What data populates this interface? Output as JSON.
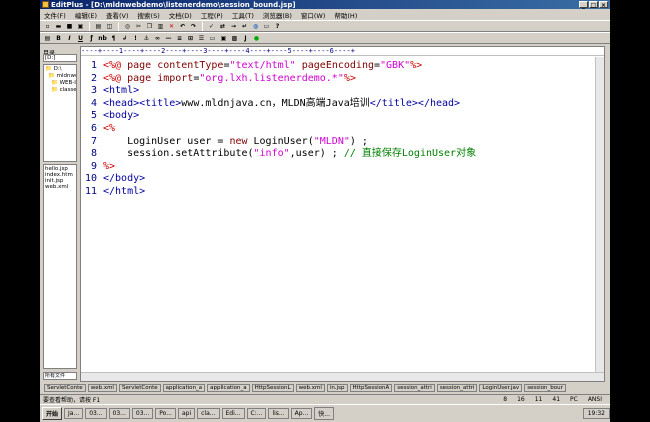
{
  "window": {
    "title": "EditPlus - [D:\\mldnwebdemo\\listenerdemo\\session_bound.jsp]"
  },
  "menu": [
    "文件(F)",
    "编辑(E)",
    "查看(V)",
    "搜索(S)",
    "文档(D)",
    "工程(P)",
    "工具(T)",
    "浏览器(B)",
    "窗口(W)",
    "帮助(H)"
  ],
  "sidebar": {
    "label": "目录",
    "drive": "[D:]",
    "tree": [
      "D:\\",
      "mldnwebd",
      "WEB-IN",
      "classe"
    ],
    "files": [
      "hello.jsp",
      "index.htm",
      "init.jsp",
      "web.xml"
    ],
    "filter": "所有文件"
  },
  "ruler": "----+----1----+----2----+----3----+----4----+----5----+----6----+",
  "code": [
    {
      "n": "1",
      "segs": [
        [
          "dir",
          "<%@ "
        ],
        [
          "kw",
          "page "
        ],
        [
          "kw",
          "contentType"
        ],
        [
          "",
          "="
        ],
        [
          "str",
          "\"text/html\""
        ],
        [
          "",
          " "
        ],
        [
          "kw",
          "pageEncoding"
        ],
        [
          "",
          "="
        ],
        [
          "str",
          "\"GBK\""
        ],
        [
          "dir",
          "%>"
        ]
      ]
    },
    {
      "n": "2",
      "segs": [
        [
          "dir",
          "<%@ "
        ],
        [
          "kw",
          "page "
        ],
        [
          "kw",
          "import"
        ],
        [
          "",
          "="
        ],
        [
          "str",
          "\"org.lxh.listenerdemo.*\""
        ],
        [
          "dir",
          "%>"
        ]
      ]
    },
    {
      "n": "3",
      "segs": [
        [
          "tag",
          "<html>"
        ]
      ]
    },
    {
      "n": "4",
      "segs": [
        [
          "tag",
          "<head><title>"
        ],
        [
          "",
          "www.mldnjava.cn，MLDN高端Java培训"
        ],
        [
          "tag",
          "</title></head>"
        ]
      ]
    },
    {
      "n": "5",
      "segs": [
        [
          "tag",
          "<body>"
        ]
      ]
    },
    {
      "n": "6",
      "segs": [
        [
          "dir",
          "<%"
        ]
      ]
    },
    {
      "n": "7",
      "segs": [
        [
          "",
          "    LoginUser user = "
        ],
        [
          "kw",
          "new"
        ],
        [
          "",
          " LoginUser("
        ],
        [
          "str",
          "\"MLDN\""
        ],
        [
          "",
          ") ;"
        ]
      ]
    },
    {
      "n": "8",
      "segs": [
        [
          "",
          "    session.setAttribute("
        ],
        [
          "str",
          "\"info\""
        ],
        [
          "",
          ",user) ; "
        ],
        [
          "cm",
          "// 直接保存LoginUser对象"
        ]
      ]
    },
    {
      "n": "9",
      "segs": [
        [
          "dir",
          "%>"
        ]
      ]
    },
    {
      "n": "10",
      "segs": [
        [
          "tag",
          "</body>"
        ]
      ]
    },
    {
      "n": "11",
      "segs": [
        [
          "tag",
          "</html>"
        ]
      ]
    }
  ],
  "tabs": [
    "ServletConte",
    "web.xml",
    "ServletConte",
    "application_a",
    "application_a",
    "HttpSessionL",
    "web.xml",
    "in.jsp",
    "HttpSessionA",
    "session_attri",
    "session_attri",
    "LoginUser.jav",
    "session_bour"
  ],
  "status": {
    "help": "要查看帮助，请按 F1",
    "ln": "8",
    "col": "16",
    "lines": "11",
    "pos": "41",
    "mode": "PC",
    "enc": "ANSI"
  },
  "taskbar": {
    "start": "开始",
    "tasks": [
      "Ja...",
      "03...",
      "03...",
      "03...",
      "Po...",
      "api",
      "cla...",
      "Edi...",
      "C:...",
      "lis...",
      "Ap...",
      "快..."
    ],
    "clock": "19:32"
  }
}
